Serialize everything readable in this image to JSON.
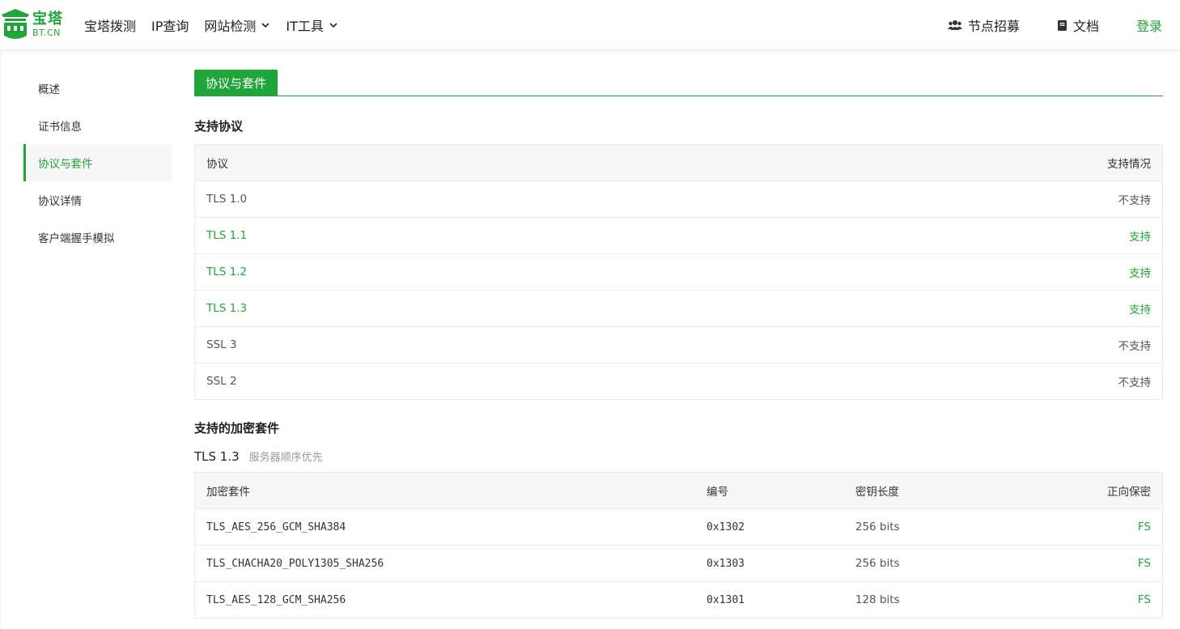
{
  "header": {
    "logo_cn": "宝塔",
    "logo_en": "BT.CN",
    "nav": [
      {
        "label": "宝塔拨测",
        "dropdown": false
      },
      {
        "label": "IP查询",
        "dropdown": false
      },
      {
        "label": "网站检测",
        "dropdown": true
      },
      {
        "label": "IT工具",
        "dropdown": true
      }
    ],
    "right": {
      "recruit": "节点招募",
      "docs": "文档",
      "login": "登录"
    }
  },
  "sidebar": {
    "items": [
      {
        "label": "概述"
      },
      {
        "label": "证书信息"
      },
      {
        "label": "协议与套件",
        "active": true
      },
      {
        "label": "协议详情"
      },
      {
        "label": "客户端握手模拟"
      }
    ]
  },
  "main": {
    "tab": "协议与套件",
    "protocols": {
      "title": "支持协议",
      "headers": [
        "协议",
        "支持情况"
      ],
      "rows": [
        {
          "name": "TLS 1.0",
          "status": "不支持",
          "supported": false
        },
        {
          "name": "TLS 1.1",
          "status": "支持",
          "supported": true
        },
        {
          "name": "TLS 1.2",
          "status": "支持",
          "supported": true
        },
        {
          "name": "TLS 1.3",
          "status": "支持",
          "supported": true
        },
        {
          "name": "SSL 3",
          "status": "不支持",
          "supported": false
        },
        {
          "name": "SSL 2",
          "status": "不支持",
          "supported": false
        }
      ]
    },
    "ciphers": {
      "title": "支持的加密套件",
      "version": "TLS 1.3",
      "note": "服务器顺序优先",
      "headers": [
        "加密套件",
        "编号",
        "密钥长度",
        "正向保密"
      ],
      "rows": [
        {
          "suite": "TLS_AES_256_GCM_SHA384",
          "code": "0x1302",
          "bits": "256 bits",
          "fs": "FS"
        },
        {
          "suite": "TLS_CHACHA20_POLY1305_SHA256",
          "code": "0x1303",
          "bits": "256 bits",
          "fs": "FS"
        },
        {
          "suite": "TLS_AES_128_GCM_SHA256",
          "code": "0x1301",
          "bits": "128 bits",
          "fs": "FS"
        }
      ]
    }
  },
  "colors": {
    "brand": "#20a53a",
    "header_bg": "#f7f7f7"
  }
}
